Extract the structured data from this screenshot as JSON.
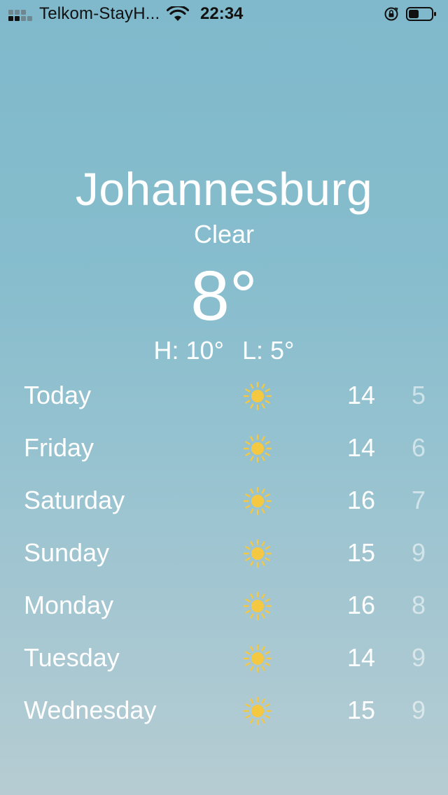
{
  "status_bar": {
    "carrier": "Telkom-StayH...",
    "time": "22:34",
    "icons": [
      "signal-icon",
      "wifi-icon",
      "orientation-lock-icon",
      "battery-icon"
    ]
  },
  "header": {
    "city": "Johannesburg",
    "condition": "Clear",
    "temperature": "8°",
    "high": "H: 10°",
    "low": "L: 5°"
  },
  "forecast": [
    {
      "day": "Today",
      "icon": "sun-icon",
      "high": "14",
      "low": "5"
    },
    {
      "day": "Friday",
      "icon": "sun-icon",
      "high": "14",
      "low": "6"
    },
    {
      "day": "Saturday",
      "icon": "sun-icon",
      "high": "16",
      "low": "7"
    },
    {
      "day": "Sunday",
      "icon": "sun-icon",
      "high": "15",
      "low": "9"
    },
    {
      "day": "Monday",
      "icon": "sun-icon",
      "high": "16",
      "low": "8"
    },
    {
      "day": "Tuesday",
      "icon": "sun-icon",
      "high": "14",
      "low": "9"
    },
    {
      "day": "Wednesday",
      "icon": "sun-icon",
      "high": "15",
      "low": "9"
    }
  ],
  "colors": {
    "sun": "#f5c842",
    "background_top": "#7fb9cb",
    "background_bottom": "#b6ccd2"
  }
}
